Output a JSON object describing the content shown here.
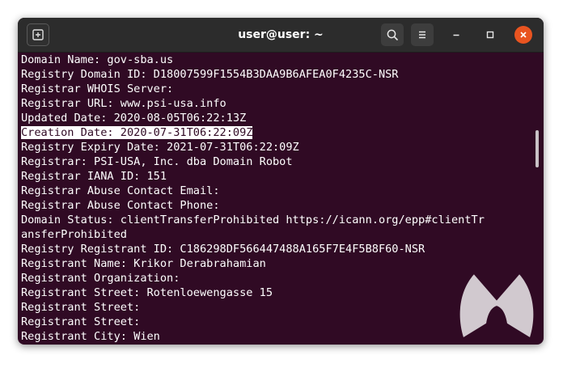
{
  "window": {
    "title": "user@user: ~"
  },
  "icons": {
    "new_tab": "new-tab-icon",
    "search": "search-icon",
    "menu": "hamburger-menu-icon",
    "minimize": "minimize-icon",
    "maximize": "maximize-icon",
    "close": "close-icon",
    "watermark": "malwarebytes-logo"
  },
  "colors": {
    "terminal_bg": "#300a24",
    "titlebar_bg": "#2c2c2c",
    "close_button": "#e95420",
    "text": "#ffffff"
  },
  "terminal": {
    "lines": [
      "Domain Name: gov-sba.us",
      "Registry Domain ID: D18007599F1554B3DAA9B6AFEA0F4235C-NSR",
      "Registrar WHOIS Server:",
      "Registrar URL: www.psi-usa.info",
      "Updated Date: 2020-08-05T06:22:13Z",
      "Creation Date: 2020-07-31T06:22:09Z",
      "Registry Expiry Date: 2021-07-31T06:22:09Z",
      "Registrar: PSI-USA, Inc. dba Domain Robot",
      "Registrar IANA ID: 151",
      "Registrar Abuse Contact Email:",
      "Registrar Abuse Contact Phone:",
      "Domain Status: clientTransferProhibited https://icann.org/epp#clientTr",
      "ansferProhibited",
      "Registry Registrant ID: C186298DF566447488A165F7E4F5B8F60-NSR",
      "Registrant Name: Krikor Derabrahamian",
      "Registrant Organization:",
      "Registrant Street: Rotenloewengasse 15",
      "Registrant Street:",
      "Registrant Street:",
      "Registrant City: Wien"
    ],
    "selected_line_index": 5
  }
}
